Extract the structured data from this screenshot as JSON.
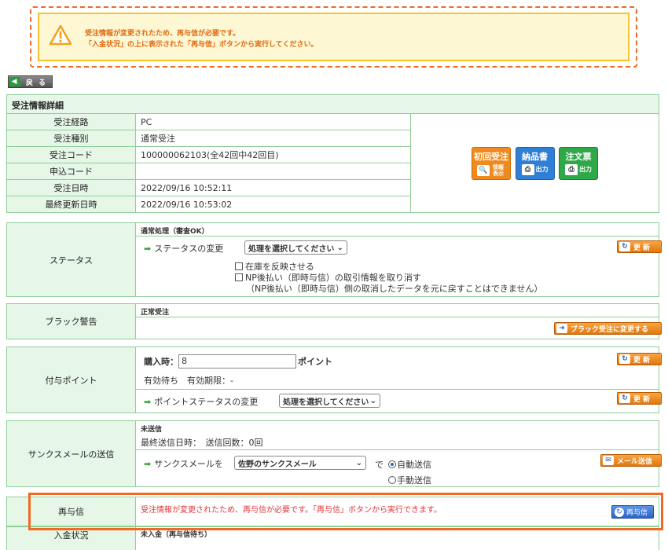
{
  "warning": {
    "line1": "受注情報が変更されたため、再与信が必要です。",
    "line2": "「入金状況」の上に表示された「再与信」ボタンから実行してください。"
  },
  "back_button": "戻 る",
  "section_title": "受注情報詳細",
  "info_rows": [
    {
      "label": "受注経路",
      "value": "PC"
    },
    {
      "label": "受注種別",
      "value": "通常受注"
    },
    {
      "label": "受注コード",
      "value": "100000062103(全42回中42回目)"
    },
    {
      "label": "申込コード",
      "value": ""
    },
    {
      "label": "受注日時",
      "value": "2022/09/16 10:52:11"
    },
    {
      "label": "最終更新日時",
      "value": "2022/09/16 10:53:02"
    }
  ],
  "doc_buttons": {
    "first_order": {
      "title": "初回受注",
      "sub": "情報表示",
      "color": "#f08a1e"
    },
    "delivery_note": {
      "title": "納品書",
      "sub": "出力",
      "color": "#2f7fd6"
    },
    "order_form": {
      "title": "注文票",
      "sub": "出力",
      "color": "#2fa84a"
    }
  },
  "status": {
    "label": "ステータス",
    "current": "通常処理（審査OK）",
    "change_label": "ステータスの変更",
    "select_value": "処理を選択してください",
    "update_btn": "更 新",
    "opt1": "在庫を反映させる",
    "opt2": "NP後払い（即時与信）の取引情報を取り消す",
    "opt2_note": "（NP後払い（即時与信）側の取消したデータを元に戻すことはできません）"
  },
  "black": {
    "label": "ブラック警告",
    "current": "正常受注",
    "btn": "ブラック受注に変更する"
  },
  "points": {
    "label": "付与ポイント",
    "purchase_label": "購入時：",
    "purchase_value": "8",
    "unit": "ポイント",
    "pending": "有効待ち　有効期限：-",
    "update_btn": "更 新",
    "change_label": "ポイントステータスの変更",
    "select_value": "処理を選択してください",
    "update_btn2": "更 新"
  },
  "thanks": {
    "label": "サンクスメールの送信",
    "current": "未送信",
    "last_sent": "最終送信日時：　送信回数：0回",
    "mail_label": "サンクスメールを",
    "select_value": "佐野のサンクスメール",
    "de": "で",
    "auto": "自動送信",
    "manual": "手動送信",
    "send_btn": "メール送信"
  },
  "recredit": {
    "label": "再与信",
    "message": "受注情報が変更されたため、再与信が必要です。「再与信」ボタンから実行できます。",
    "btn": "再与信"
  },
  "payment": {
    "label": "入金状況",
    "current": "未入金（再与信待ち）"
  }
}
